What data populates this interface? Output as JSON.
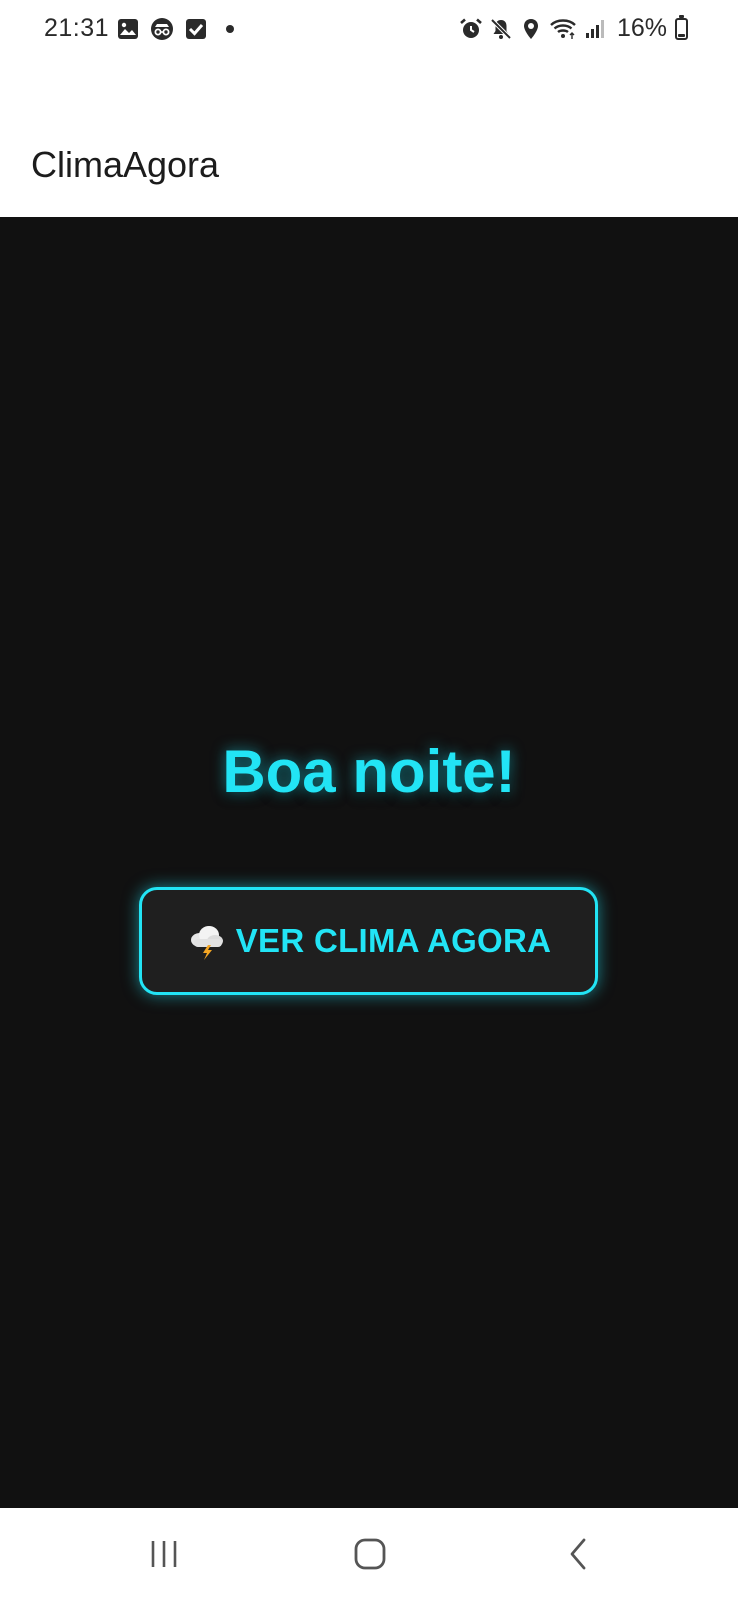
{
  "status_bar": {
    "time": "21:31",
    "battery_percent": "16%",
    "left_icons": [
      "image-icon",
      "incognito-icon",
      "checkbox-icon",
      "dot-icon"
    ],
    "right_icons": [
      "alarm-icon",
      "mute-icon",
      "location-icon",
      "wifi-icon",
      "signal-icon",
      "battery-icon"
    ],
    "battery_level": 0.16
  },
  "app_bar": {
    "title": "ClimaAgora"
  },
  "main": {
    "greeting": "Boa noite!",
    "cta_label": "VER CLIMA AGORA",
    "cta_icon": "storm-cloud-icon"
  },
  "nav_bar": {
    "buttons": [
      "recent-apps-icon",
      "home-icon",
      "back-icon"
    ]
  },
  "colors": {
    "accent": "#22e4f5",
    "background": "#111111",
    "button_bg": "#1f1f1f"
  }
}
